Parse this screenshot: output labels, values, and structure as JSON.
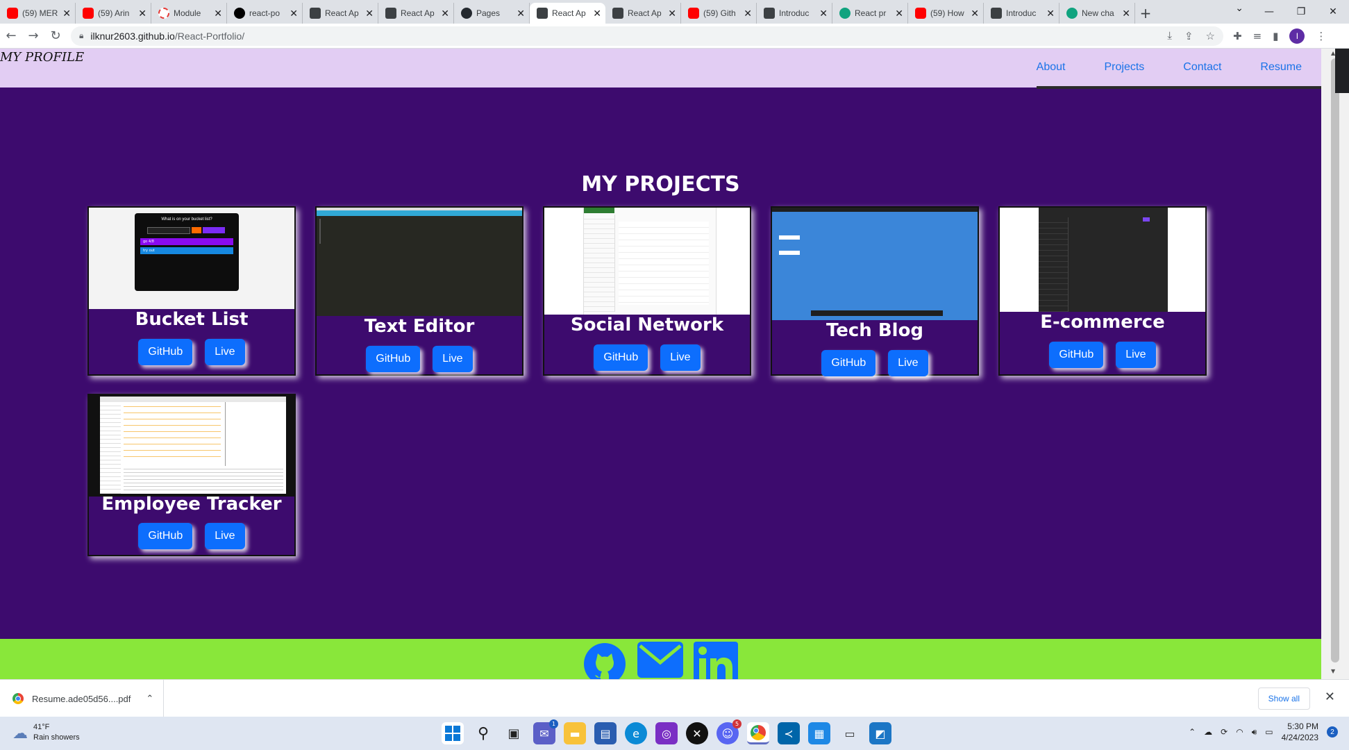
{
  "browser": {
    "tabs": [
      {
        "label": "(59) MER",
        "icon": "youtube-icon"
      },
      {
        "label": "(59) Arin",
        "icon": "youtube-icon"
      },
      {
        "label": "Module",
        "icon": "loading-icon"
      },
      {
        "label": "react-po",
        "icon": "netlify-icon"
      },
      {
        "label": "React Ap",
        "icon": "react-icon"
      },
      {
        "label": "React Ap",
        "icon": "react-icon"
      },
      {
        "label": "Pages",
        "icon": "github-icon"
      },
      {
        "label": "React Ap",
        "icon": "react-icon",
        "active": true
      },
      {
        "label": "React Ap",
        "icon": "react-icon"
      },
      {
        "label": "(59) Gith",
        "icon": "youtube-icon"
      },
      {
        "label": "Introduc",
        "icon": "course-icon"
      },
      {
        "label": "React pr",
        "icon": "chatgpt-icon"
      },
      {
        "label": "(59) How",
        "icon": "youtube-icon"
      },
      {
        "label": "Introduc",
        "icon": "course-icon"
      },
      {
        "label": "New cha",
        "icon": "chatgpt-icon"
      }
    ],
    "url_host": "ilknur2603.github.io",
    "url_path": "/React-Portfolio/",
    "profile_initial": "I"
  },
  "site": {
    "brand": "MY PROFILE",
    "nav": [
      "About",
      "Projects",
      "Contact",
      "Resume"
    ],
    "section_title": "MY PROJECTS",
    "projects": [
      {
        "name": "Bucket List",
        "github": "GitHub",
        "live": "Live"
      },
      {
        "name": "Text Editor",
        "github": "GitHub",
        "live": "Live"
      },
      {
        "name": "Social Network",
        "github": "GitHub",
        "live": "Live"
      },
      {
        "name": "Tech Blog",
        "github": "GitHub",
        "live": "Live"
      },
      {
        "name": "E-commerce",
        "github": "GitHub",
        "live": "Live"
      },
      {
        "name": "Employee Tracker",
        "github": "GitHub",
        "live": "Live"
      }
    ],
    "bucket_preview": {
      "heading": "What is on your bucket list?",
      "row1": "go 4/8",
      "row2": "try out"
    },
    "social": [
      "github-icon",
      "email-icon",
      "linkedin-icon"
    ],
    "colors": {
      "page_bg": "#3d0b6e",
      "header_bg": "#e2cdf3",
      "footer_bg": "#89e73a",
      "button": "#0d6efd",
      "social_icon": "#0d6efd"
    }
  },
  "downloads": {
    "file": "Resume.ade05d56....pdf",
    "show_all": "Show all"
  },
  "taskbar": {
    "weather_temp": "41°F",
    "weather_desc": "Rain showers",
    "time": "5:30 PM",
    "date": "4/24/2023",
    "notifications": "2",
    "teams_badge": "1",
    "discord_badge": "5"
  }
}
